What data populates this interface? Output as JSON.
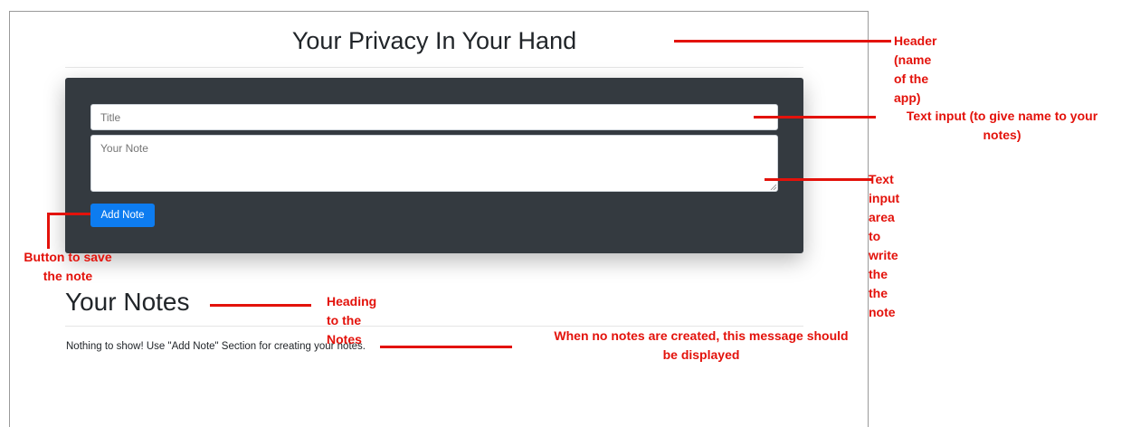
{
  "app": {
    "title": "Your Privacy In Your Hand"
  },
  "note_form": {
    "title_placeholder": "Title",
    "note_placeholder": "Your Note",
    "add_button_label": "Add Note"
  },
  "notes_section": {
    "heading": "Your Notes",
    "empty_message": "Nothing to show! Use \"Add Note\" Section for creating your notes."
  },
  "annotations": {
    "header": "Header (name of the app)",
    "text_input_line1": "Text input (to give name to your",
    "text_input_line2": "notes)",
    "text_area": "Text input area to write the the note",
    "button_line1": "Button to save",
    "button_line2": "the note",
    "notes_heading": "Heading to the Notes",
    "empty_line1": "When no notes are created, this message should",
    "empty_line2": "be displayed",
    "color": "#e3120b"
  }
}
